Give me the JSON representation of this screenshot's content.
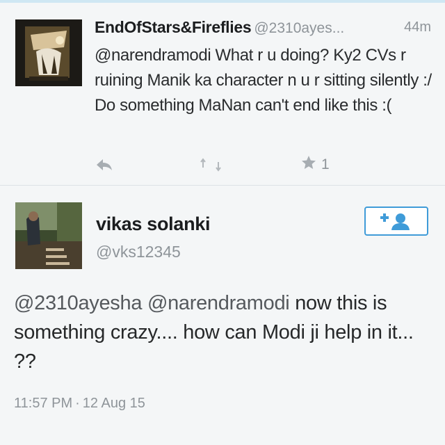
{
  "reply_tweet": {
    "author_name": "EndOfStars&Fireflies",
    "author_handle": "@2310ayes...",
    "time_ago": "44m",
    "text": "@narendramodi What r u doing? Ky2 CVs r ruining Manik ka character n u r sitting silently :/ Do something MaNan can't end like this :(",
    "favorite_count": "1",
    "icons": [
      "reply-icon",
      "retweet-icon",
      "star-icon"
    ]
  },
  "main_tweet": {
    "author_name": "vikas solanki",
    "author_handle": "@vks12345",
    "follow_icon": "add-user-icon",
    "mention_1": "@2310ayesha",
    "mention_2": "@narendramodi",
    "text_rest": "now this is something crazy.... how can Modi ji help in it... ??",
    "time": "11:57 PM",
    "separator": "·",
    "date": "12 Aug 15"
  },
  "colors": {
    "background": "#f4f6f7",
    "text": "#262829",
    "secondary_text": "#8e9499",
    "follow_blue": "#3f9bd8"
  }
}
